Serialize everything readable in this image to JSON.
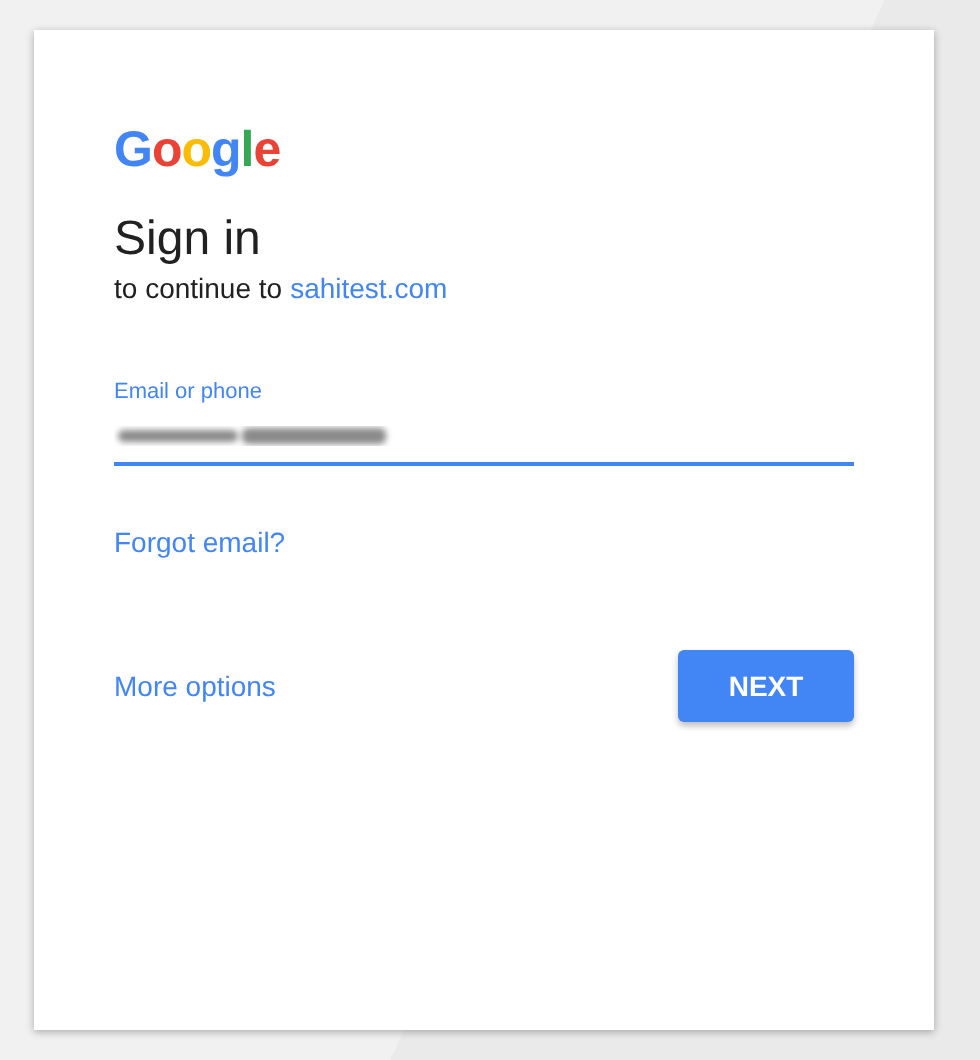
{
  "logo": [
    {
      "text": "G",
      "color": "#4285f4"
    },
    {
      "text": "o",
      "color": "#ea4335"
    },
    {
      "text": "o",
      "color": "#fbbc05"
    },
    {
      "text": "g",
      "color": "#4285f4"
    },
    {
      "text": "l",
      "color": "#34a853"
    },
    {
      "text": "e",
      "color": "#ea4335"
    }
  ],
  "heading": "Sign in",
  "subheading": {
    "text": "to continue to",
    "link": "sahitest.com"
  },
  "email_field": {
    "label": "Email or phone",
    "focused": true,
    "value_redacted": true
  },
  "forgot_link": "Forgot email?",
  "more_options_link": "More options",
  "next_button": "NEXT"
}
